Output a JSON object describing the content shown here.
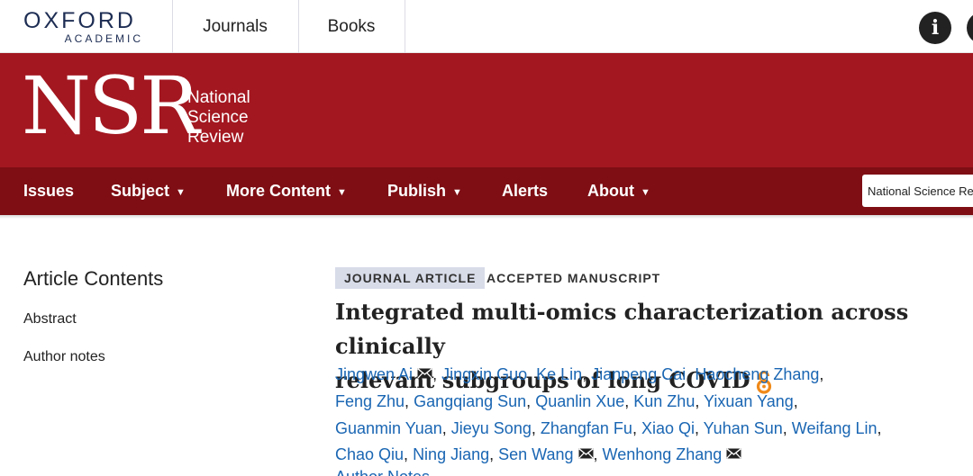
{
  "topbar": {
    "logo_main": "OXFORD",
    "logo_sub": "ACADEMIC",
    "links": [
      "Journals",
      "Books"
    ]
  },
  "banner": {
    "abbr": "NSR",
    "name_lines": [
      "National",
      "Science",
      "Review"
    ],
    "color": "#a31720"
  },
  "nav": {
    "items": [
      {
        "label": "Issues",
        "caret": false
      },
      {
        "label": "Subject",
        "caret": true
      },
      {
        "label": "More Content",
        "caret": true
      },
      {
        "label": "Publish",
        "caret": true
      },
      {
        "label": "Alerts",
        "caret": false
      },
      {
        "label": "About",
        "caret": true
      }
    ],
    "search_value": "National Science Re",
    "color": "#7e0e14"
  },
  "sidebar": {
    "heading": "Article Contents",
    "links": [
      "Abstract",
      "Author notes"
    ]
  },
  "article": {
    "type_badge": "JOURNAL ARTICLE",
    "status": "ACCEPTED MANUSCRIPT",
    "title_line1": "Integrated multi-omics characterization across clinically",
    "title_line2": "relevant subgroups of long COVID",
    "open_access_icon": "open-access-icon",
    "author_lines": [
      [
        {
          "name": "Jingwen Ai",
          "mail": true
        },
        {
          "name": "Jingxin Guo",
          "mail": false
        },
        {
          "name": "Ke Lin",
          "mail": false
        },
        {
          "name": "Jianpeng Cai",
          "mail": false
        },
        {
          "name": "Haocheng Zhang",
          "mail": false
        }
      ],
      [
        {
          "name": "Feng Zhu",
          "mail": false
        },
        {
          "name": "Gangqiang Sun",
          "mail": false
        },
        {
          "name": "Quanlin Xue",
          "mail": false
        },
        {
          "name": "Kun Zhu",
          "mail": false
        },
        {
          "name": "Yixuan Yang",
          "mail": false
        }
      ],
      [
        {
          "name": "Guanmin Yuan",
          "mail": false
        },
        {
          "name": "Jieyu Song",
          "mail": false
        },
        {
          "name": "Zhangfan Fu",
          "mail": false
        },
        {
          "name": "Xiao Qi",
          "mail": false
        },
        {
          "name": "Yuhan Sun",
          "mail": false
        },
        {
          "name": "Weifang Lin",
          "mail": false
        }
      ],
      [
        {
          "name": "Chao Qiu",
          "mail": false
        },
        {
          "name": "Ning Jiang",
          "mail": false
        },
        {
          "name": "Sen Wang",
          "mail": true
        },
        {
          "name": "Wenhong Zhang",
          "mail": true
        }
      ]
    ],
    "line_end_separators": [
      ",",
      ",",
      ",",
      ""
    ],
    "author_notes_link": "Author Notes",
    "link_color": "#1a66b3"
  }
}
